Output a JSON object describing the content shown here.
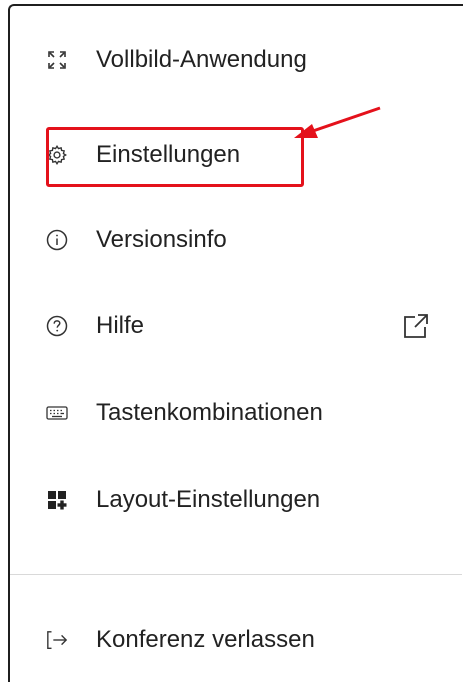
{
  "menu": {
    "items": [
      {
        "label": "Vollbild-Anwendung",
        "icon": "fullscreen-icon"
      },
      {
        "label": "Einstellungen",
        "icon": "gear-icon"
      },
      {
        "label": "Versionsinfo",
        "icon": "info-icon"
      },
      {
        "label": "Hilfe",
        "icon": "help-icon",
        "trailing_icon": "external-link-icon"
      },
      {
        "label": "Tastenkombinationen",
        "icon": "keyboard-icon"
      },
      {
        "label": "Layout-Einstellungen",
        "icon": "layout-icon"
      }
    ],
    "footer_item": {
      "label": "Konferenz verlassen",
      "icon": "logout-icon"
    }
  },
  "annotation": {
    "highlight_color": "#e4111b",
    "highlighted_item": "Einstellungen"
  }
}
